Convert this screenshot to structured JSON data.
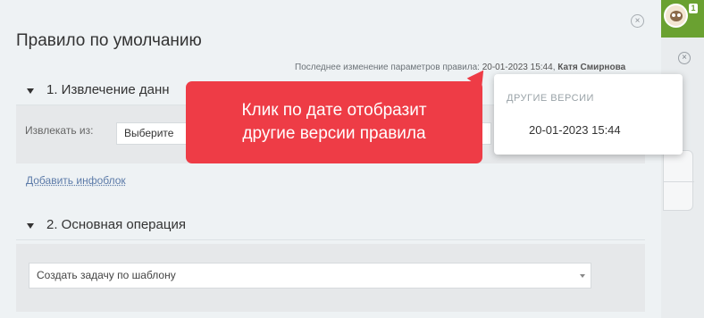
{
  "panel": {
    "title": "Правило по умолчанию",
    "last_modified": {
      "prefix": "Последнее изменение параметров правила: ",
      "date": "20-01-2023 15:44",
      "separator": ", ",
      "author": "Катя Смирнова"
    },
    "close_icon": "×"
  },
  "section1": {
    "label": "1. Извлечение данн",
    "extract_label": "Извлекать из:",
    "select_value": "Выберите",
    "add_link": "Добавить инфоблок"
  },
  "section2": {
    "label": "2. Основная операция",
    "select_value": "Создать задачу по шаблону"
  },
  "callout": {
    "line1": "Клик по дате отобразит",
    "line2": "другие версии правила",
    "color": "#ee3c46"
  },
  "versions_popup": {
    "header": "ДРУГИЕ ВЕРСИИ",
    "items": [
      "20-01-2023 15:44"
    ]
  },
  "background": {
    "avatar_badge": "1",
    "close_icon": "×",
    "header_color": "#6aa131"
  }
}
